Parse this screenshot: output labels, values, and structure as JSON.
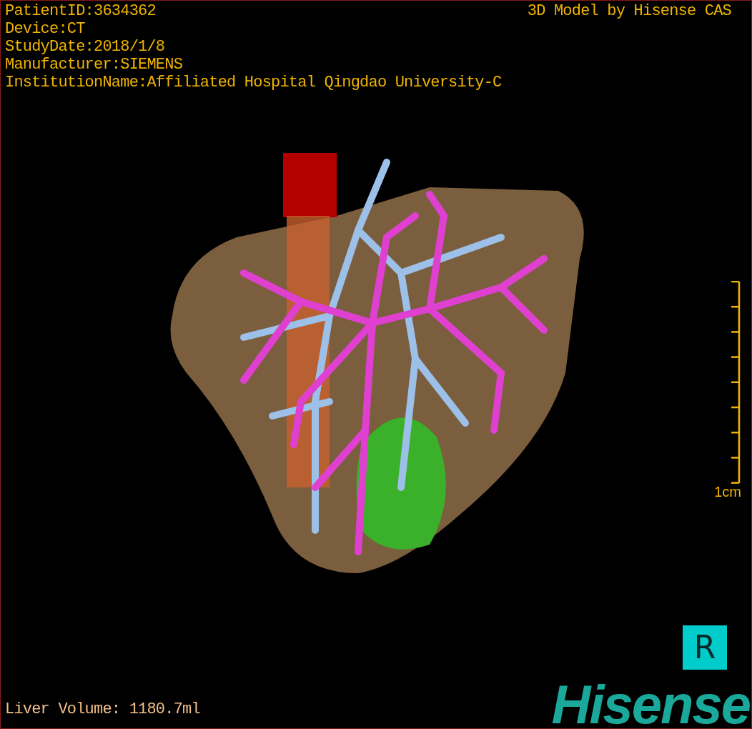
{
  "patient_info": [
    "PatientID:3634362",
    "Device:CT",
    "StudyDate:2018/1/8",
    "Manufacturer:SIEMENS",
    "InstitutionName:Affiliated Hospital Qingdao University-C"
  ],
  "title": "3D Model by Hisense CAS",
  "scale": {
    "label": "1cm"
  },
  "orientation_marker": "R",
  "liver_volume": "Liver Volume: 1180.7ml",
  "logo": "Hisense"
}
